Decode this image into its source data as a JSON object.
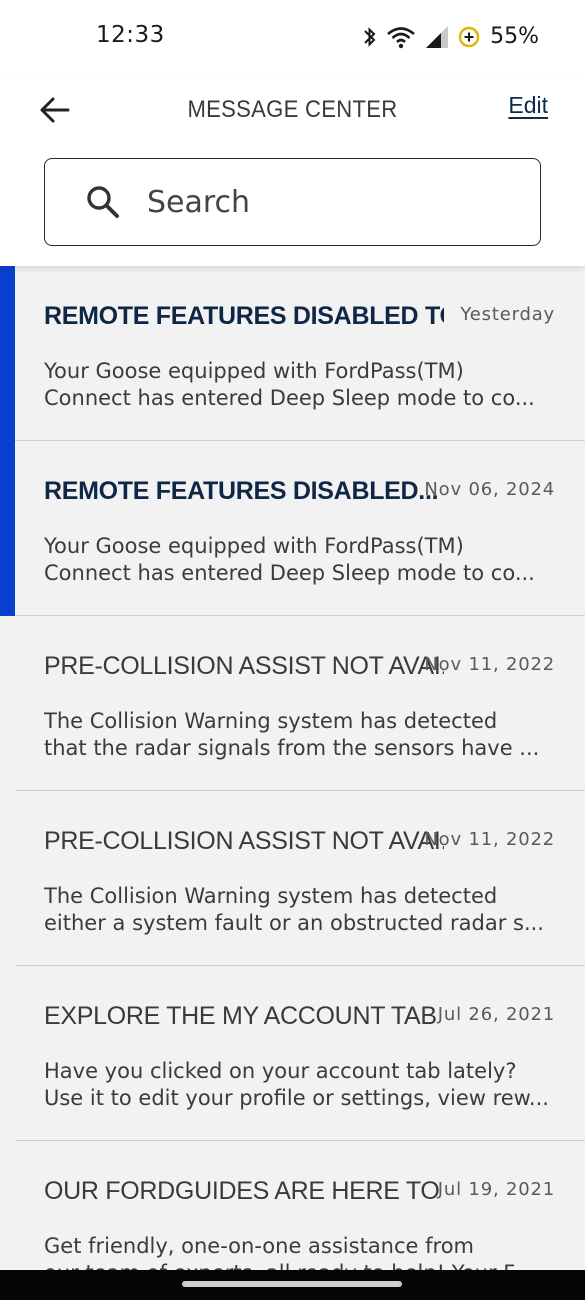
{
  "status_bar": {
    "time": "12:33",
    "battery": "55%",
    "icons": [
      "bluetooth-icon",
      "wifi-icon",
      "signal-icon",
      "battery-saver-icon"
    ]
  },
  "header": {
    "title": "MESSAGE CENTER",
    "edit_label": "Edit",
    "back_icon": "arrow-left-icon"
  },
  "search": {
    "placeholder": "Search"
  },
  "colors": {
    "unread_accent": "#0a3fcf",
    "unread_title": "#0f2747",
    "edit_link": "#102b4e"
  },
  "messages": [
    {
      "title": "REMOTE FEATURES DISABLED TO ...",
      "date": "Yesterday",
      "line1": "Your Goose equipped with FordPass(TM)",
      "line2": "Connect has entered Deep Sleep mode to co...",
      "unread": true
    },
    {
      "title": "REMOTE FEATURES DISABLED...",
      "date": "Nov 06, 2024",
      "line1": "Your Goose equipped with FordPass(TM)",
      "line2": "Connect has entered Deep Sleep mode to co...",
      "unread": true
    },
    {
      "title": "PRE-COLLISION ASSIST NOT AVAI...",
      "date": "Nov 11, 2022",
      "line1": "The Collision Warning system has detected",
      "line2": "that the radar signals from the sensors have ...",
      "unread": false
    },
    {
      "title": "PRE-COLLISION ASSIST NOT AVAI...",
      "date": "Nov 11, 2022",
      "line1": "The Collision Warning system has detected",
      "line2": "either a system fault or an obstructed radar s...",
      "unread": false
    },
    {
      "title": "EXPLORE THE MY ACCOUNT TAB",
      "date": "Jul 26, 2021",
      "line1": "Have you clicked on your account tab lately?",
      "line2": "Use it to edit your profile or settings, view rew...",
      "unread": false
    },
    {
      "title": "OUR FORDGUIDES ARE HERE TO HE...",
      "date": "Jul 19, 2021",
      "line1": "Get friendly, one-on-one assistance from",
      "line2": "our team of experts, all ready to help! Your F...",
      "unread": false
    }
  ]
}
